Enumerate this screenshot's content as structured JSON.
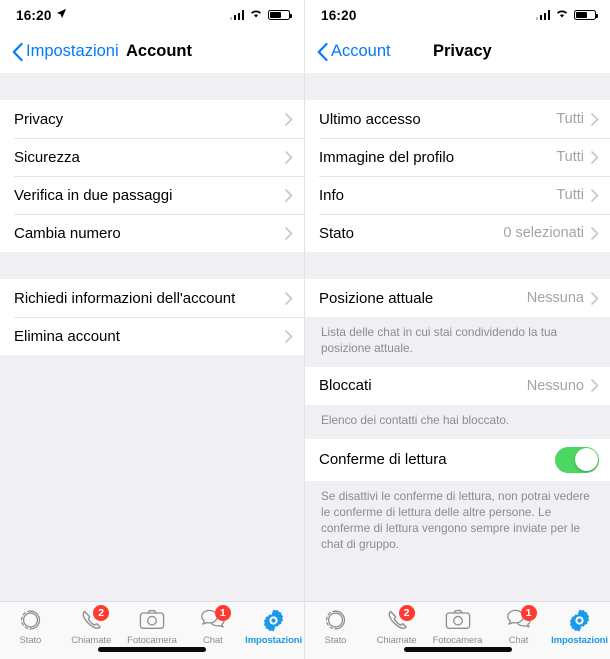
{
  "colors": {
    "ios_blue": "#007aff",
    "tab_active": "#1a9ae8",
    "badge_red": "#ff3b30",
    "toggle_green": "#4cd662",
    "group_bg": "#efeff4",
    "value_gray": "#a4a4a8"
  },
  "left": {
    "status": {
      "time": "16:20",
      "location_icon": "location-arrow-icon"
    },
    "nav": {
      "back_label": "Impostazioni",
      "title": "Account"
    },
    "group1": [
      {
        "label": "Privacy",
        "value": ""
      },
      {
        "label": "Sicurezza",
        "value": ""
      },
      {
        "label": "Verifica in due passaggi",
        "value": ""
      },
      {
        "label": "Cambia numero",
        "value": ""
      }
    ],
    "group2": [
      {
        "label": "Richiedi informazioni dell'account",
        "value": ""
      },
      {
        "label": "Elimina account",
        "value": ""
      }
    ]
  },
  "right": {
    "status": {
      "time": "16:20"
    },
    "nav": {
      "back_label": "Account",
      "title": "Privacy"
    },
    "group1": [
      {
        "label": "Ultimo accesso",
        "value": "Tutti"
      },
      {
        "label": "Immagine del profilo",
        "value": "Tutti"
      },
      {
        "label": "Info",
        "value": "Tutti"
      },
      {
        "label": "Stato",
        "value": "0 selezionati"
      }
    ],
    "location_row": {
      "label": "Posizione attuale",
      "value": "Nessuna"
    },
    "location_footer": "Lista delle chat in cui stai condividendo la tua posizione attuale.",
    "blocked_row": {
      "label": "Bloccati",
      "value": "Nessuno"
    },
    "blocked_footer": "Elenco dei contatti che hai bloccato.",
    "receipts_row": {
      "label": "Conferme di lettura",
      "toggle": "on"
    },
    "receipts_footer": "Se disattivi le conferme di lettura, non potrai vedere le conferme di lettura delle altre persone. Le conferme di lettura vengono sempre inviate per le chat di gruppo."
  },
  "tabbar": {
    "items": [
      {
        "label": "Stato",
        "icon": "status-rings-icon",
        "badge": "",
        "active": false
      },
      {
        "label": "Chiamate",
        "icon": "phone-icon",
        "badge": "2",
        "active": false
      },
      {
        "label": "Fotocamera",
        "icon": "camera-icon",
        "badge": "",
        "active": false
      },
      {
        "label": "Chat",
        "icon": "chat-bubbles-icon",
        "badge": "1",
        "active": false
      },
      {
        "label": "Impostazioni",
        "icon": "gear-icon",
        "badge": "",
        "active": true
      }
    ]
  }
}
